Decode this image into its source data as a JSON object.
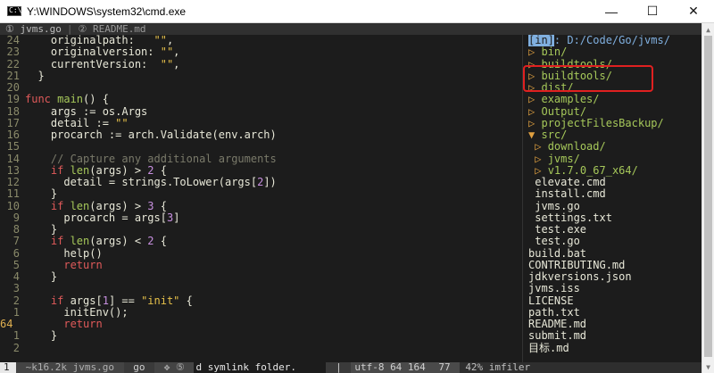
{
  "window": {
    "title": "Y:\\WINDOWS\\system32\\cmd.exe",
    "icon_label": "C:\\",
    "minimize": "—",
    "maximize": "☐",
    "close": "✕"
  },
  "tabs": [
    {
      "label": "① jvms.go",
      "active": true
    },
    {
      "label": "② README.md",
      "active": false
    }
  ],
  "tab_separator": "|",
  "code_lines": [
    {
      "ln": "24",
      "parts": [
        [
          "txt",
          "    originalpath:   "
        ],
        [
          "str",
          "\"\""
        ],
        [
          "txt",
          ","
        ]
      ]
    },
    {
      "ln": "23",
      "parts": [
        [
          "txt",
          "    originalversion: "
        ],
        [
          "str",
          "\"\""
        ],
        [
          "txt",
          ","
        ]
      ]
    },
    {
      "ln": "22",
      "parts": [
        [
          "txt",
          "    currentVersion:  "
        ],
        [
          "str",
          "\"\""
        ],
        [
          "txt",
          ","
        ]
      ]
    },
    {
      "ln": "21",
      "parts": [
        [
          "txt",
          "  }"
        ]
      ]
    },
    {
      "ln": "20",
      "parts": [
        [
          "txt",
          ""
        ]
      ]
    },
    {
      "ln": "19",
      "parts": [
        [
          "kw",
          "func "
        ],
        [
          "fn",
          "main"
        ],
        [
          "txt",
          "() {"
        ]
      ]
    },
    {
      "ln": "18",
      "parts": [
        [
          "txt",
          "    args := os.Args"
        ]
      ]
    },
    {
      "ln": "17",
      "parts": [
        [
          "txt",
          "    detail := "
        ],
        [
          "str",
          "\"\""
        ]
      ]
    },
    {
      "ln": "16",
      "parts": [
        [
          "txt",
          "    procarch := arch.Validate(env.arch)"
        ]
      ]
    },
    {
      "ln": "15",
      "parts": [
        [
          "txt",
          ""
        ]
      ]
    },
    {
      "ln": "14",
      "parts": [
        [
          "cm",
          "    // Capture any additional arguments"
        ]
      ]
    },
    {
      "ln": "13",
      "parts": [
        [
          "kw",
          "    if "
        ],
        [
          "fn",
          "len"
        ],
        [
          "txt",
          "(args) > "
        ],
        [
          "num",
          "2"
        ],
        [
          "txt",
          " {"
        ]
      ]
    },
    {
      "ln": "12",
      "parts": [
        [
          "txt",
          "      detail = strings.ToLower(args["
        ],
        [
          "num",
          "2"
        ],
        [
          "txt",
          "])"
        ]
      ]
    },
    {
      "ln": "11",
      "parts": [
        [
          "txt",
          "    }"
        ]
      ]
    },
    {
      "ln": "10",
      "parts": [
        [
          "kw",
          "    if "
        ],
        [
          "fn",
          "len"
        ],
        [
          "txt",
          "(args) > "
        ],
        [
          "num",
          "3"
        ],
        [
          "txt",
          " {"
        ]
      ]
    },
    {
      "ln": "9",
      "parts": [
        [
          "txt",
          "      procarch = args["
        ],
        [
          "num",
          "3"
        ],
        [
          "txt",
          "]"
        ]
      ]
    },
    {
      "ln": "8",
      "parts": [
        [
          "txt",
          "    }"
        ]
      ]
    },
    {
      "ln": "7",
      "parts": [
        [
          "kw",
          "    if "
        ],
        [
          "fn",
          "len"
        ],
        [
          "txt",
          "(args) < "
        ],
        [
          "num",
          "2"
        ],
        [
          "txt",
          " {"
        ]
      ]
    },
    {
      "ln": "6",
      "parts": [
        [
          "txt",
          "      help()"
        ]
      ]
    },
    {
      "ln": "5",
      "parts": [
        [
          "kw",
          "      return"
        ]
      ]
    },
    {
      "ln": "4",
      "parts": [
        [
          "txt",
          "    }"
        ]
      ]
    },
    {
      "ln": "3",
      "parts": [
        [
          "txt",
          ""
        ]
      ]
    },
    {
      "ln": "2",
      "parts": [
        [
          "kw",
          "    if "
        ],
        [
          "txt",
          "args["
        ],
        [
          "num",
          "1"
        ],
        [
          "txt",
          "] == "
        ],
        [
          "str",
          "\"init\""
        ],
        [
          "txt",
          " {"
        ]
      ]
    },
    {
      "ln": "1",
      "parts": [
        [
          "txt",
          "      initEnv();"
        ]
      ]
    },
    {
      "ln": "64",
      "current": true,
      "parts": [
        [
          "kw",
          "      return"
        ]
      ]
    },
    {
      "ln": "1",
      "parts": [
        [
          "txt",
          "    }"
        ]
      ]
    },
    {
      "ln": "2",
      "parts": [
        [
          "txt",
          ""
        ]
      ]
    }
  ],
  "tree": {
    "root_tag": "[in]",
    "root_path": ": D:/Code/Go/jvms/",
    "items": [
      {
        "kind": "dir",
        "indent": "",
        "arrow": "▷",
        "name": "bin/"
      },
      {
        "kind": "dir",
        "indent": "",
        "arrow": "▷",
        "name": "buildtools/"
      },
      {
        "kind": "dir",
        "indent": "",
        "arrow": "▷",
        "name": "buildtools/"
      },
      {
        "kind": "dir",
        "indent": "",
        "arrow": "▷",
        "name": "dist/"
      },
      {
        "kind": "dir",
        "indent": "",
        "arrow": "▷",
        "name": "examples/"
      },
      {
        "kind": "dir",
        "indent": "",
        "arrow": "▷",
        "name": "Output/"
      },
      {
        "kind": "dir",
        "indent": "",
        "arrow": "▷",
        "name": "projectFilesBackup/"
      },
      {
        "kind": "dir",
        "indent": "",
        "arrow": "▼",
        "name": "src/"
      },
      {
        "kind": "dir",
        "indent": " ",
        "arrow": "▷",
        "name": "download/"
      },
      {
        "kind": "dir",
        "indent": " ",
        "arrow": "▷",
        "name": "jvms/"
      },
      {
        "kind": "dir",
        "indent": " ",
        "arrow": "▷",
        "name": "v1.7.0_67_x64/"
      },
      {
        "kind": "file",
        "indent": " ",
        "arrow": "",
        "name": "elevate.cmd"
      },
      {
        "kind": "file",
        "indent": " ",
        "arrow": "",
        "name": "install.cmd"
      },
      {
        "kind": "file",
        "indent": " ",
        "arrow": "",
        "name": "jvms.go"
      },
      {
        "kind": "file",
        "indent": " ",
        "arrow": "",
        "name": "settings.txt"
      },
      {
        "kind": "file",
        "indent": " ",
        "arrow": "",
        "name": "test.exe"
      },
      {
        "kind": "file",
        "indent": " ",
        "arrow": "",
        "name": "test.go"
      },
      {
        "kind": "file",
        "indent": "",
        "arrow": "",
        "name": "build.bat"
      },
      {
        "kind": "file",
        "indent": "",
        "arrow": "",
        "name": "CONTRIBUTING.md"
      },
      {
        "kind": "file",
        "indent": "",
        "arrow": "",
        "name": "jdkversions.json"
      },
      {
        "kind": "file",
        "indent": "",
        "arrow": "",
        "name": "jvms.iss"
      },
      {
        "kind": "file",
        "indent": "",
        "arrow": "",
        "name": "LICENSE"
      },
      {
        "kind": "file",
        "indent": "",
        "arrow": "",
        "name": "path.txt"
      },
      {
        "kind": "file",
        "indent": "",
        "arrow": "",
        "name": "README.md"
      },
      {
        "kind": "file",
        "indent": "",
        "arrow": "",
        "name": "submit.md"
      },
      {
        "kind": "file",
        "indent": "",
        "arrow": "",
        "name": "目标.md"
      }
    ]
  },
  "statusline": {
    "mode": "1",
    "file": " ~k16.2k jvms.go ",
    "filetype": " go ",
    "icons": " ✥ ⑤ ",
    "message": "d symlink folder.",
    "sep": " | ",
    "encoding": "utf-8 64 164",
    "col": " 77 ",
    "tree_info": "42% imfiler"
  },
  "colors": {
    "background": "#1c1c1c",
    "keyword": "#e05a5a",
    "function": "#a6c85a",
    "string": "#e6c04a",
    "number": "#c890e0",
    "comment": "#7a7a6a",
    "directory": "#a6c85a",
    "highlight_box": "#e02020"
  }
}
